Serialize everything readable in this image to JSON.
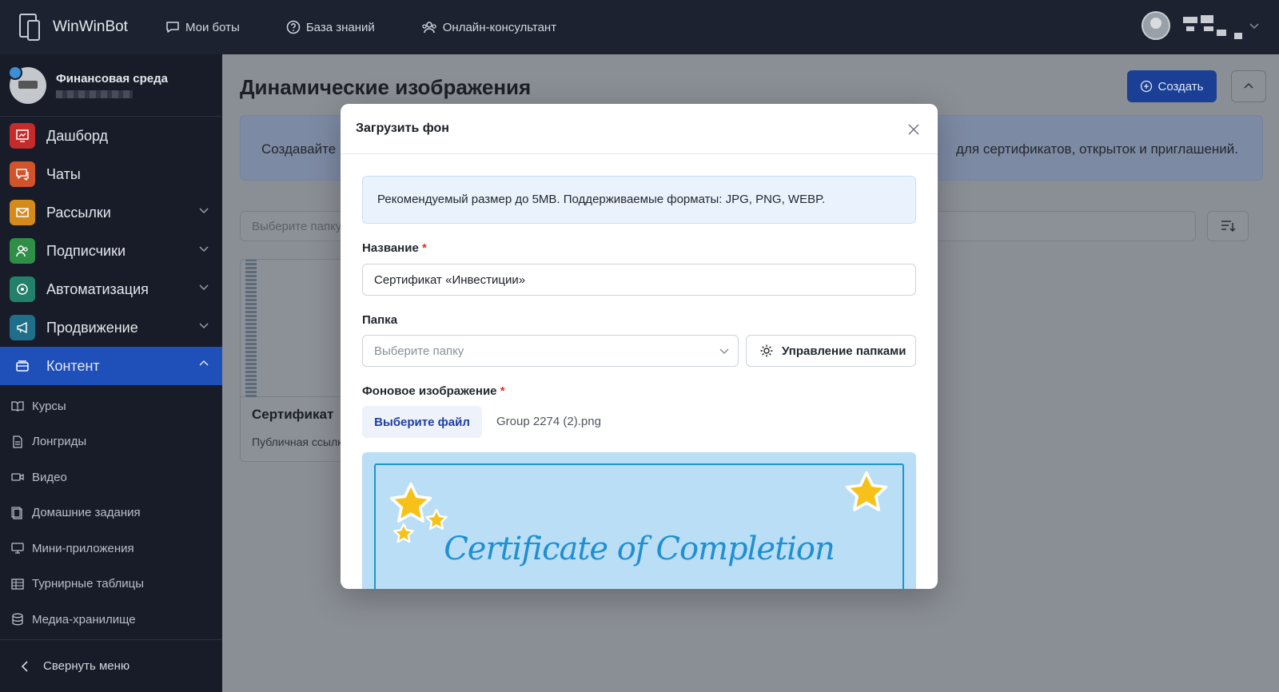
{
  "topbar": {
    "brand": "WinWinBot",
    "nav": [
      {
        "label": "Мои боты",
        "icon": "chat-bubble-icon"
      },
      {
        "label": "База знаний",
        "icon": "help-circle-icon"
      },
      {
        "label": "Онлайн-консультант",
        "icon": "users-icon"
      }
    ]
  },
  "sidebar": {
    "bot_name": "Финансовая среда",
    "menu": [
      {
        "label": "Дашборд",
        "color": "#c42b2b",
        "icon": "dashboard-icon"
      },
      {
        "label": "Чаты",
        "color": "#d0532a",
        "icon": "chats-icon"
      },
      {
        "label": "Рассылки",
        "color": "#d58a1c",
        "icon": "mail-icon"
      },
      {
        "label": "Подписчики",
        "color": "#2f8f46",
        "icon": "subscribers-icon"
      },
      {
        "label": "Автоматизация",
        "color": "#23806a",
        "icon": "automation-icon"
      },
      {
        "label": "Продвижение",
        "color": "#1f6f8a",
        "icon": "megaphone-icon"
      },
      {
        "label": "Контент",
        "color": "#1f4fb8",
        "icon": "content-icon"
      }
    ],
    "submenu": [
      {
        "label": "Курсы",
        "icon": "book-icon"
      },
      {
        "label": "Лонгриды",
        "icon": "document-icon"
      },
      {
        "label": "Видео",
        "icon": "video-icon"
      },
      {
        "label": "Домашние задания",
        "icon": "homework-icon"
      },
      {
        "label": "Мини-приложения",
        "icon": "monitor-icon"
      },
      {
        "label": "Турнирные таблицы",
        "icon": "table-icon"
      },
      {
        "label": "Медиа-хранилище",
        "icon": "database-icon"
      }
    ],
    "collapse_label": "Свернуть меню"
  },
  "main": {
    "title": "Динамические изображения",
    "create_label": "Создать",
    "info_left": "Создавайте",
    "info_right": "для сертификатов, открыток и приглашений.",
    "filter_placeholder": "Выберите папку",
    "card_title": "Сертификат",
    "card_sub": "Публичная ссылка"
  },
  "modal": {
    "title": "Загрузить фон",
    "notice": "Рекомендуемый размер до 5MB. Поддерживаемые форматы: JPG, PNG, WEBP.",
    "name_label": "Название",
    "name_value": "Сертификат «Инвестиции»",
    "folder_label": "Папка",
    "folder_placeholder": "Выберите папку",
    "manage_folders": "Управление папками",
    "bg_label": "Фоновое изображение",
    "file_button": "Выберите файл",
    "file_name": "Group 2274 (2).png",
    "preview_text": "Certificate of Completion",
    "required_mark": "*"
  },
  "colors": {
    "accent": "#1f4fb8",
    "topbar": "#1c2230",
    "sidebar": "#171c28"
  }
}
